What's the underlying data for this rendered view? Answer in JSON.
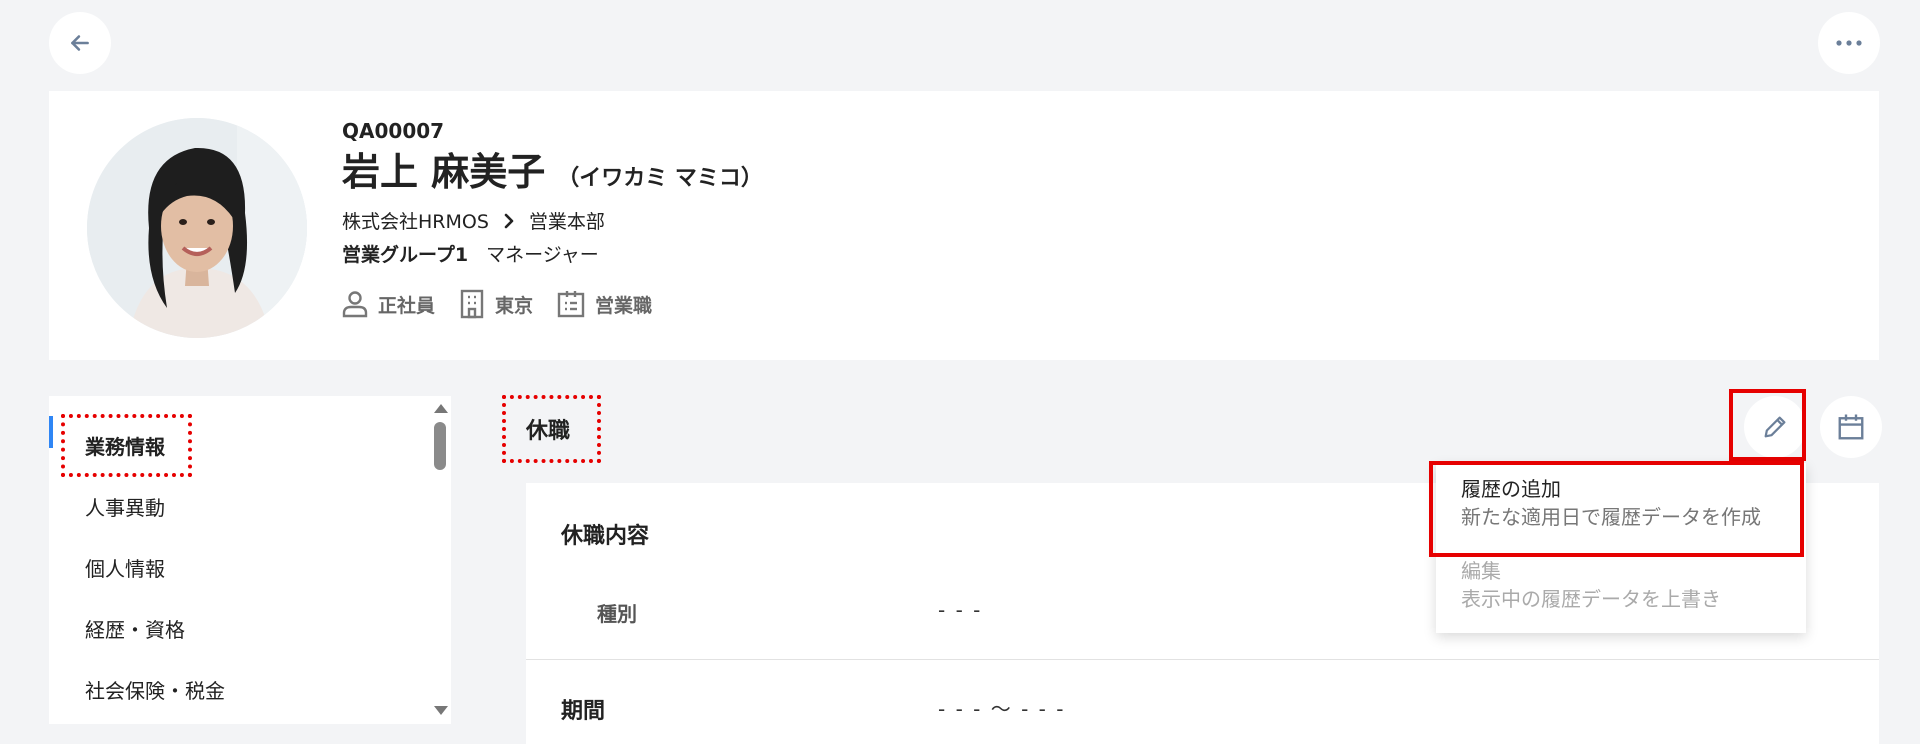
{
  "profile": {
    "employee_code": "QA00007",
    "name": "岩上 麻美子",
    "name_kana": "（イワカミ マミコ）",
    "company": "株式会社HRMOS",
    "department": "営業本部",
    "group": "営業グループ1",
    "position": "マネージャー",
    "tags": {
      "employment_type": "正社員",
      "location": "東京",
      "job_type": "営業職"
    }
  },
  "nav": {
    "items": [
      {
        "label": "業務情報"
      },
      {
        "label": "人事異動"
      },
      {
        "label": "個人情報"
      },
      {
        "label": "経歴・資格"
      },
      {
        "label": "社会保険・税金"
      }
    ]
  },
  "section": {
    "title": "休職"
  },
  "content": {
    "card_heading": "休職内容",
    "type_label": "種別",
    "type_value": "- - -",
    "period_heading": "期間",
    "period_value": "- - - 〜 - - -"
  },
  "dropdown": {
    "items": [
      {
        "title": "履歴の追加",
        "description": "新たな適用日で履歴データを作成"
      },
      {
        "title": "編集",
        "description": "表示中の履歴データを上書き"
      }
    ]
  },
  "icons": {
    "back": "arrow-left-icon",
    "more": "more-horizontal-icon",
    "edit": "pencil-icon",
    "calendar": "calendar-icon"
  },
  "colors": {
    "accent": "#2f86f5",
    "highlight": "#e60000",
    "background": "#f3f4f6"
  }
}
